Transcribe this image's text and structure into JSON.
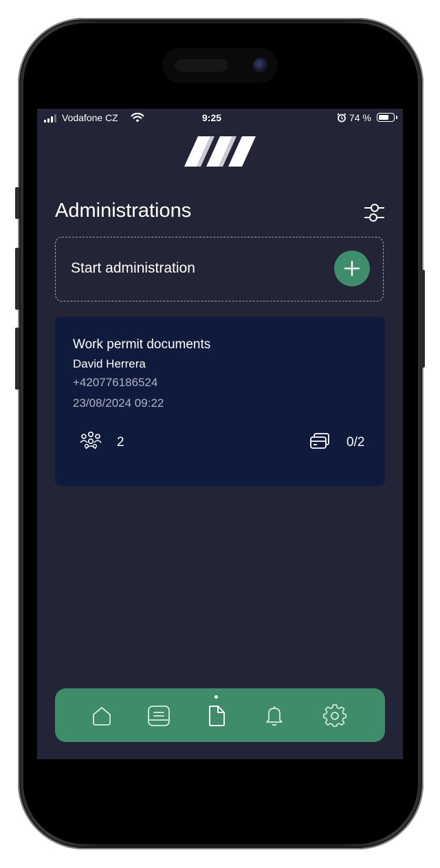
{
  "status_bar": {
    "carrier": "Vodafone CZ",
    "time": "9:25",
    "battery": "74 %",
    "battery_level": 0.74,
    "signal_bars": 3
  },
  "header": {
    "logo_icon": "brand-logo-icon"
  },
  "page": {
    "title": "Administrations",
    "filter_icon": "sliders-icon"
  },
  "start": {
    "label": "Start administration",
    "add_icon": "plus-icon"
  },
  "administrations": [
    {
      "title": "Work permit documents",
      "name": "David Herrera",
      "phone": "+420776186524",
      "date": "23/08/2024 09:22",
      "people_count": "2",
      "documents": "0/2"
    }
  ],
  "tabbar": {
    "items": [
      {
        "icon": "home-icon",
        "active": false
      },
      {
        "icon": "inbox-icon",
        "active": false
      },
      {
        "icon": "document-icon",
        "active": true
      },
      {
        "icon": "bell-icon",
        "active": false
      },
      {
        "icon": "gear-icon",
        "active": false
      }
    ]
  },
  "colors": {
    "background": "#232537",
    "card": "#0f1b3d",
    "accent": "#3f8c6a",
    "text": "#ffffff",
    "muted": "#aeb2c4"
  }
}
